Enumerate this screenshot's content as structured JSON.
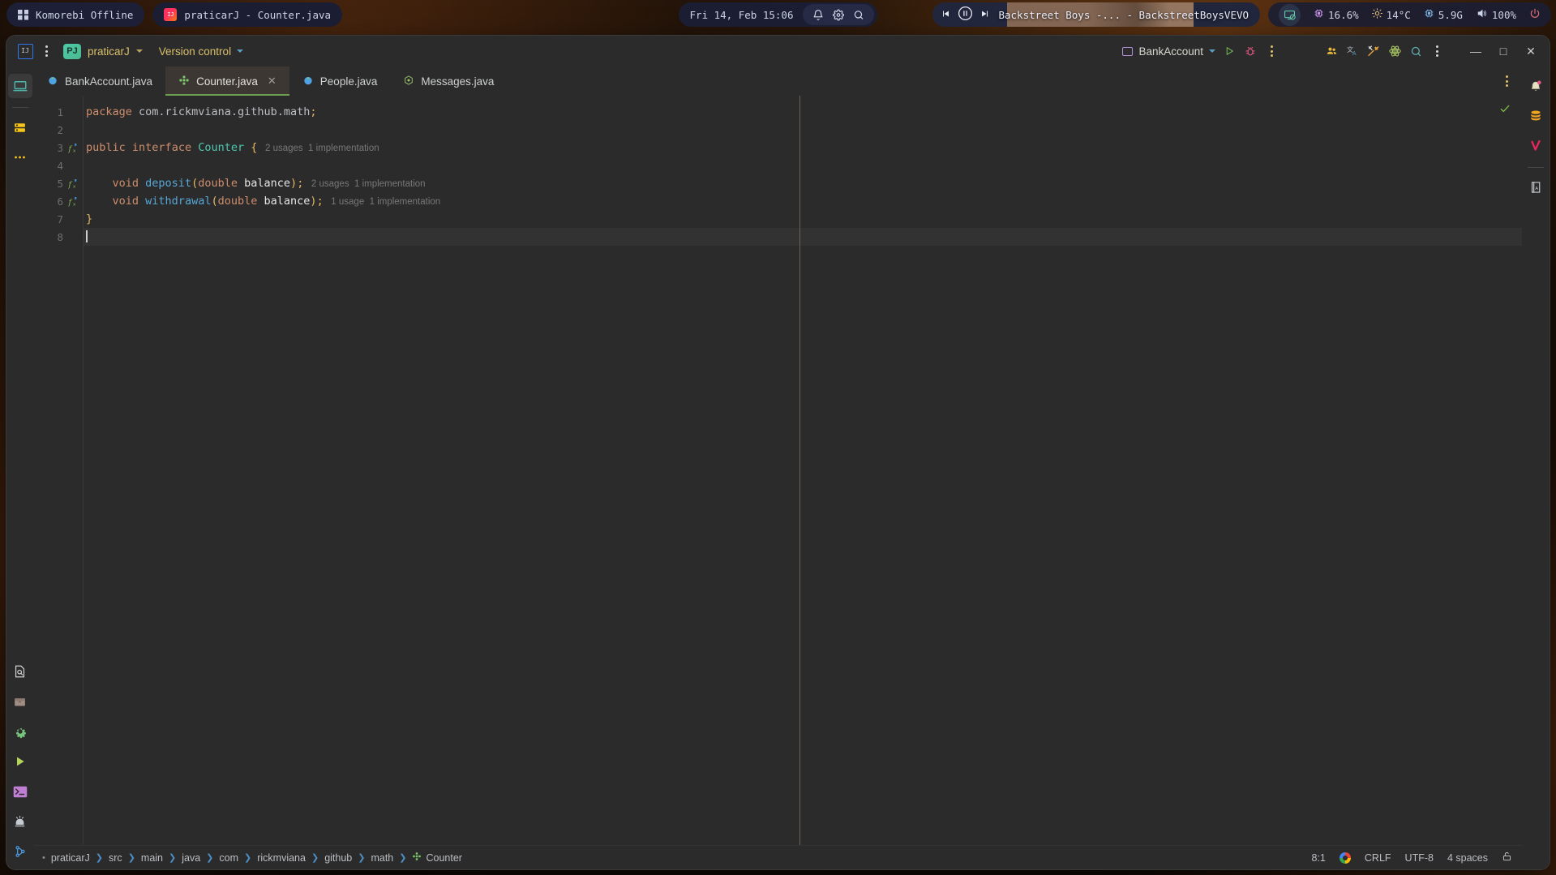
{
  "topbar": {
    "workspace_label": "Komorebi Offline",
    "active_window": "praticarJ - Counter.java",
    "clock": "Fri 14, Feb 15:06",
    "sys_icons": [
      "bell-icon",
      "gear-icon",
      "search-icon"
    ],
    "media": {
      "title": "Backstreet Boys -... - BackstreetBoysVEVO",
      "prev_icon": "previous-track-icon",
      "play_pause_icon": "pause-icon",
      "next_icon": "next-track-icon"
    },
    "stats": {
      "display_icon": "display-off-icon",
      "cpu_icon": "cpu-icon",
      "cpu": "16.6%",
      "temp_icon": "brightness-icon",
      "temp": "14°C",
      "memory_icon": "memory-icon",
      "memory": "5.9G",
      "volume_icon": "speaker-icon",
      "volume": "100%",
      "power_icon": "power-icon"
    }
  },
  "ide": {
    "titlebar": {
      "app_icon": "intellij-idea-icon",
      "main_menu_icon": "hamburger-menu-icon",
      "project_badge": "PJ",
      "project_name": "praticarJ",
      "version_control": "Version control",
      "run_config": "BankAccount",
      "run_icon": "run-icon",
      "debug_icon": "debug-icon",
      "more_icon": "more-options-icon",
      "right_icons": [
        "collaborate-icon",
        "translate-icon",
        "build-tools-icon",
        "atom-ai-icon",
        "search-everywhere-icon",
        "more-vertical-icon"
      ],
      "minimize": "—",
      "maximize": "□",
      "close": "✕"
    },
    "tabs": [
      {
        "label": "BankAccount.java",
        "icon": "java-class-icon",
        "active": false,
        "closable": false
      },
      {
        "label": "Counter.java",
        "icon": "java-interface-icon",
        "active": true,
        "closable": true
      },
      {
        "label": "People.java",
        "icon": "java-class-icon",
        "active": false,
        "closable": false
      },
      {
        "label": "Messages.java",
        "icon": "java-record-icon",
        "active": false,
        "closable": false
      }
    ],
    "tab_options_icon": "tab-options-icon",
    "left_rail_top": [
      "project-icon",
      "commit-icon",
      "more-tool-windows-icon"
    ],
    "left_rail_bottom": [
      "find-icon",
      "package-icon",
      "settings-icon",
      "run-tool-icon",
      "terminal-icon",
      "problems-icon",
      "git-branch-icon"
    ],
    "right_rail": [
      "notifications-icon",
      "database-icon",
      "vercel-icon",
      "translation-icon"
    ],
    "editor": {
      "inspection_status_icon": "inspections-ok-check",
      "lines": [
        {
          "num": "1",
          "fx": false,
          "current": false,
          "tokens": [
            {
              "t": "package",
              "c": "k-kw"
            },
            {
              "t": " ",
              "c": "k-plain"
            },
            {
              "t": "com.rickmviana.github.math",
              "c": "k-plain"
            },
            {
              "t": ";",
              "c": "k-punc"
            }
          ],
          "hints": []
        },
        {
          "num": "2",
          "fx": false,
          "current": false,
          "tokens": [],
          "hints": []
        },
        {
          "num": "3",
          "fx": true,
          "current": false,
          "tokens": [
            {
              "t": "public",
              "c": "k-kw"
            },
            {
              "t": " ",
              "c": "k-plain"
            },
            {
              "t": "interface",
              "c": "k-kw"
            },
            {
              "t": " ",
              "c": "k-plain"
            },
            {
              "t": "Counter",
              "c": "k-type"
            },
            {
              "t": " ",
              "c": "k-plain"
            },
            {
              "t": "{",
              "c": "k-brace"
            }
          ],
          "hints": [
            "2 usages",
            "1 implementation"
          ]
        },
        {
          "num": "4",
          "fx": false,
          "current": false,
          "tokens": [],
          "hints": []
        },
        {
          "num": "5",
          "fx": true,
          "current": false,
          "tokens": [
            {
              "t": "    ",
              "c": "k-plain"
            },
            {
              "t": "void",
              "c": "k-kw"
            },
            {
              "t": " ",
              "c": "k-plain"
            },
            {
              "t": "deposit",
              "c": "k-fn"
            },
            {
              "t": "(",
              "c": "k-punc"
            },
            {
              "t": "double",
              "c": "k-kw"
            },
            {
              "t": " ",
              "c": "k-plain"
            },
            {
              "t": "balance",
              "c": "k-param"
            },
            {
              "t": ")",
              "c": "k-punc"
            },
            {
              "t": ";",
              "c": "k-punc"
            }
          ],
          "hints": [
            "2 usages",
            "1 implementation"
          ]
        },
        {
          "num": "6",
          "fx": true,
          "current": false,
          "tokens": [
            {
              "t": "    ",
              "c": "k-plain"
            },
            {
              "t": "void",
              "c": "k-kw"
            },
            {
              "t": " ",
              "c": "k-plain"
            },
            {
              "t": "withdrawal",
              "c": "k-fn"
            },
            {
              "t": "(",
              "c": "k-punc"
            },
            {
              "t": "double",
              "c": "k-kw"
            },
            {
              "t": " ",
              "c": "k-plain"
            },
            {
              "t": "balance",
              "c": "k-param"
            },
            {
              "t": ")",
              "c": "k-punc"
            },
            {
              "t": ";",
              "c": "k-punc"
            }
          ],
          "hints": [
            "1 usage",
            "1 implementation"
          ]
        },
        {
          "num": "7",
          "fx": false,
          "current": false,
          "tokens": [
            {
              "t": "}",
              "c": "k-brace"
            }
          ],
          "hints": []
        },
        {
          "num": "8",
          "fx": false,
          "current": true,
          "tokens": [],
          "hints": []
        }
      ]
    },
    "statusbar": {
      "breadcrumbs": [
        "praticarJ",
        "src",
        "main",
        "java",
        "com",
        "rickmviana",
        "github",
        "math",
        "Counter"
      ],
      "breadcrumb_last_icon": "java-interface-icon",
      "caret_position": "8:1",
      "google_icon": "google-icon",
      "line_separator": "CRLF",
      "encoding": "UTF-8",
      "indent": "4 spaces",
      "lock_icon": "unlocked-icon"
    }
  },
  "colors": {
    "ide_bg": "#2b2b2b",
    "tab_active_bg": "#3d3733",
    "tab_active_underline": "#6ca050",
    "accent_yellow": "#d9c06a",
    "right_margin": "#6d6257",
    "keyword": "#cf8e6d",
    "type": "#4ec9b0",
    "method": "#57a8d8",
    "brace": "#e8b765"
  }
}
